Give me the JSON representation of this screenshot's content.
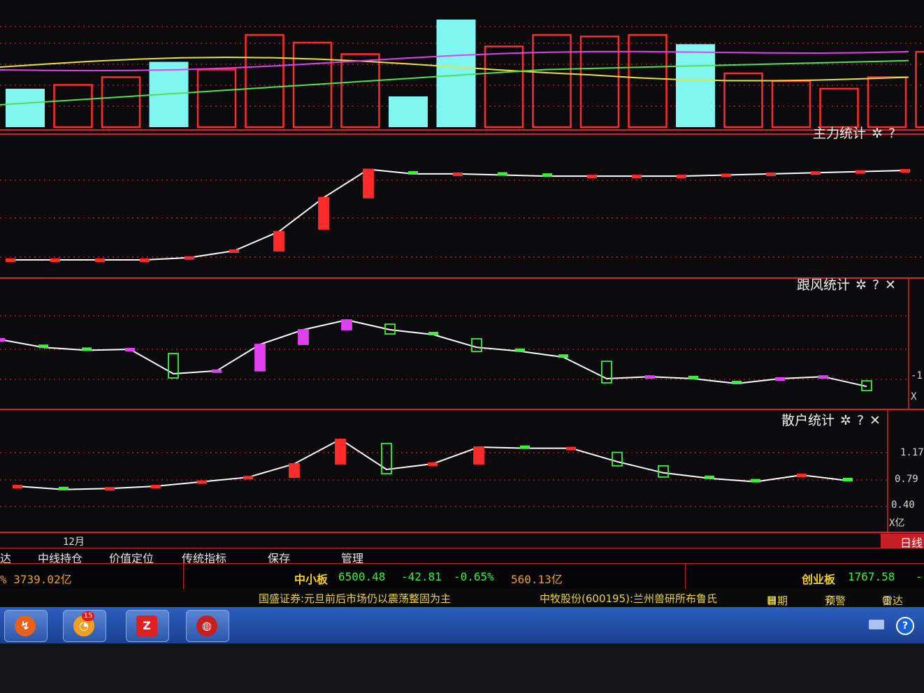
{
  "panels": {
    "main": {
      "title": "主力统计",
      "settings_icon": "gear-icon",
      "help_icon": "?"
    },
    "follow": {
      "title": "跟风统计",
      "settings_icon": "gear-icon",
      "help_icon": "?",
      "close_icon": "✕",
      "axis_unit": "X",
      "axis_tick": "-1"
    },
    "retail": {
      "title": "散户统计",
      "settings_icon": "gear-icon",
      "help_icon": "?",
      "close_icon": "✕",
      "axis_ticks": [
        "1.17",
        "0.79",
        "0.40"
      ],
      "axis_unit": "X亿"
    }
  },
  "x_axis": {
    "month_label": "12月"
  },
  "tabs": [
    "达",
    "中线持仓",
    "价值定位",
    "传统指标",
    "保存",
    "管理"
  ],
  "period_tab": "日线",
  "status_bar": {
    "left_fragment": "% 3739.02亿",
    "sme": {
      "name": "中小板",
      "index": "6500.48",
      "change": "-42.81",
      "pct": "-0.65%",
      "amount": "560.13亿"
    },
    "gem": {
      "name": "创业板",
      "index": "1767.58",
      "change": "-"
    }
  },
  "news": {
    "headline_1": "国盛证券:元旦前后市场仍以震荡整固为主",
    "headline_2": "中牧股份(600195):兰州兽研所布鲁氏",
    "calendar": "日期",
    "alert": "预警",
    "radar": "雷达"
  },
  "taskbar": {
    "badge_count": "15",
    "help_glyph": "?"
  },
  "colors": {
    "grid_red": "#d0262d",
    "up_red": "#ff2a2a",
    "down_green": "#3cf03c",
    "cyan": "#7ff6f0",
    "line_white": "#ffffff",
    "magenta": "#e040f0",
    "yellow": "#e8e040"
  },
  "chart_data": [
    {
      "type": "bar",
      "title": "",
      "note": "volume bars with moving-average overlays",
      "values": [
        0.5,
        0.55,
        0.65,
        0.85,
        0.75,
        1.2,
        1.1,
        0.95,
        0.4,
        1.4,
        1.05,
        1.2,
        1.18,
        1.2,
        1.08,
        0.7,
        0.6,
        0.5,
        0.65,
        0.98,
        0.8
      ],
      "colors": [
        "cyan",
        "red",
        "red",
        "cyan",
        "red",
        "red",
        "red",
        "red",
        "cyan",
        "cyan",
        "red",
        "red",
        "red",
        "red",
        "cyan",
        "red",
        "red",
        "red",
        "red",
        "red",
        "cyan"
      ]
    },
    {
      "type": "line",
      "title": "主力统计",
      "values": [
        0,
        0,
        0,
        0,
        0.02,
        0.08,
        0.25,
        0.55,
        0.8,
        0.76,
        0.76,
        0.75,
        0.74,
        0.74,
        0.74,
        0.74,
        0.75,
        0.76,
        0.77,
        0.78,
        0.79
      ]
    },
    {
      "type": "line",
      "title": "跟风统计",
      "values": [
        0.6,
        0.52,
        0.49,
        0.5,
        0.25,
        0.28,
        0.55,
        0.7,
        0.8,
        0.7,
        0.65,
        0.52,
        0.48,
        0.42,
        0.2,
        0.22,
        0.2,
        0.15,
        0.2,
        0.22,
        0.12
      ]
    },
    {
      "type": "line",
      "title": "散户统计",
      "y_ticks": [
        1.17,
        0.79,
        0.4
      ],
      "values": [
        0.4,
        0.37,
        0.38,
        0.4,
        0.44,
        0.48,
        0.6,
        0.82,
        0.55,
        0.6,
        0.75,
        0.74,
        0.74,
        0.62,
        0.52,
        0.47,
        0.44,
        0.5,
        0.45
      ]
    }
  ]
}
